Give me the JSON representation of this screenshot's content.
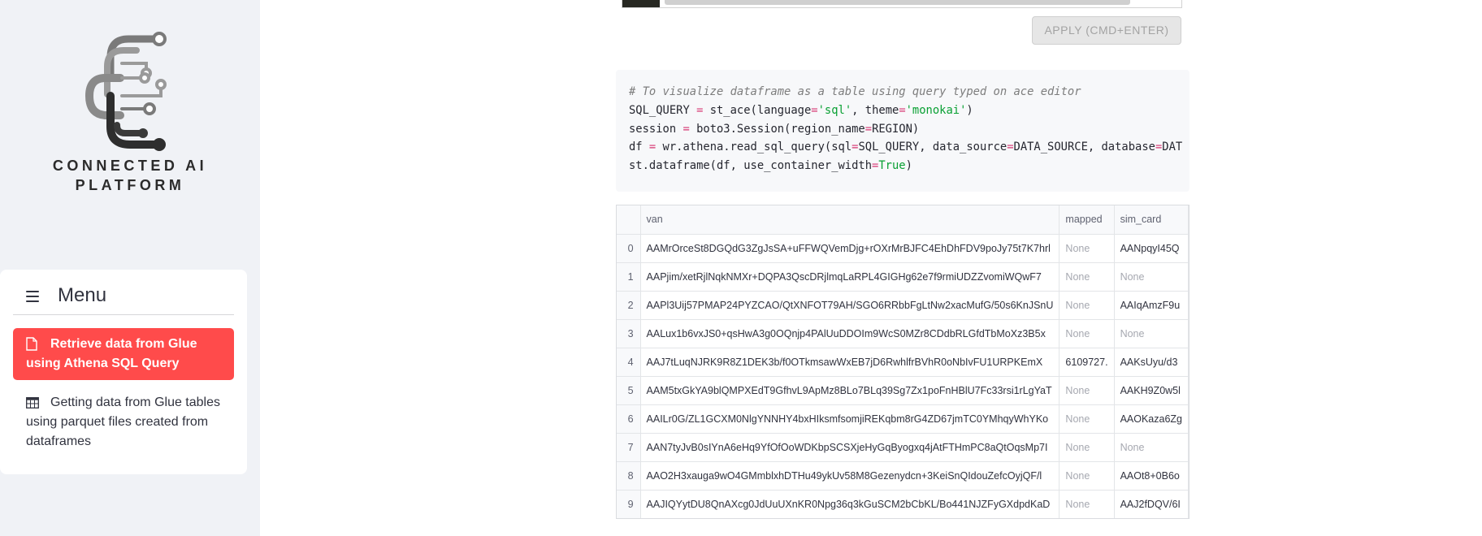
{
  "sidebar": {
    "logo_line1": "CONNECTED AI",
    "logo_line2": "PLATFORM",
    "menu_title": "Menu",
    "items": [
      {
        "label": "Retrieve data from Glue using Athena SQL Query",
        "icon": "file-icon",
        "active": true
      },
      {
        "label": "Getting data from Glue tables using parquet files created from dataframes",
        "icon": "table-icon",
        "active": false
      }
    ]
  },
  "colors": {
    "accent": "#ff4b4b",
    "sidebar_bg": "#f0f2f6"
  },
  "editor": {
    "apply_label": "APPLY (CMD+ENTER)"
  },
  "code": {
    "comment": "# To visualize dataframe as a table using query typed on ace editor",
    "l2_a": "SQL_QUERY",
    "l2_b": " = ",
    "l2_c": "st_ace(language",
    "l2_d": "=",
    "l2_e": "'sql'",
    "l2_f": ", theme",
    "l2_g": "=",
    "l2_h": "'monokai'",
    "l2_i": ")",
    "l3_a": "session",
    "l3_b": " = ",
    "l3_c": "boto3.Session(region_name",
    "l3_d": "=",
    "l3_e": "REGION)",
    "l4_a": "df",
    "l4_b": " = ",
    "l4_c": "wr.athena.read_sql_query(sql",
    "l4_d": "=",
    "l4_e": "SQL_QUERY, data_source",
    "l4_f": "=",
    "l4_g": "DATA_SOURCE, database",
    "l4_h": "=",
    "l4_i": "DAT",
    "l5_a": "st.dataframe(df, use_container_width",
    "l5_b": "=",
    "l5_c": "True",
    "l5_d": ")"
  },
  "table": {
    "columns": [
      "",
      "van",
      "mapped",
      "sim_card"
    ],
    "rows": [
      [
        "0",
        "AAMrOrceSt8DGQdG3ZgJsSA+uFFWQVemDjg+rOXrMrBJFC4EhDhFDV9poJy75t7K7hrl",
        "None",
        "AANpqyI45Q"
      ],
      [
        "1",
        "AAPjim/xetRjlNqkNMXr+DQPA3QscDRjlmqLaRPL4GIGHg62e7f9rmiUDZZvomiWQwF7",
        "None",
        "None"
      ],
      [
        "2",
        "AAPl3Uij57PMAP24PYZCAO/QtXNFOT79AH/SGO6RRbbFgLtNw2xacMufG/50s6KnJSnU",
        "None",
        "AAIqAmzF9u"
      ],
      [
        "3",
        "AALux1b6vxJS0+qsHwA3g0OQnjp4PAlUuDDOIm9WcS0MZr8CDdbRLGfdTbMoXz3B5x",
        "None",
        "None"
      ],
      [
        "4",
        "AAJ7tLuqNJRK9R8Z1DEK3b/f0OTkmsawWxEB7jD6RwhlfrBVhR0oNbIvFU1URPKEmX",
        "6109727.",
        "AAKsUyu/d3"
      ],
      [
        "5",
        "AAM5txGkYA9blQMPXEdT9GfhvL9ApMz8BLo7BLq39Sg7Zx1poFnHBlU7Fc33rsi1rLgYaT",
        "None",
        "AAKH9Z0w5l"
      ],
      [
        "6",
        "AAILr0G/ZL1GCXM0NlgYNNHY4bxHIksmfsomjiREKqbm8rG4ZD67jmTC0YMhqyWhYKo",
        "None",
        "AAOKaza6Zg"
      ],
      [
        "7",
        "AAN7tyJvB0sIYnA6eHq9YfOfOoWDKbpSCSXjeHyGqByogxq4jAtFTHmPC8aQtOqsMp7I",
        "None",
        "None"
      ],
      [
        "8",
        "AAO2H3xauga9wO4GMmblxhDTHu49ykUv58M8Gezenydcn+3KeiSnQIdouZefcOyjQF/l",
        "None",
        "AAOt8+0B6o"
      ],
      [
        "9",
        "AAJIQYytDU8QnAXcg0JdUuUXnKR0Npg36q3kGuSCM2bCbKL/Bo441NJZFyGXdpdKaD",
        "None",
        "AAJ2fDQV/6I"
      ]
    ]
  }
}
